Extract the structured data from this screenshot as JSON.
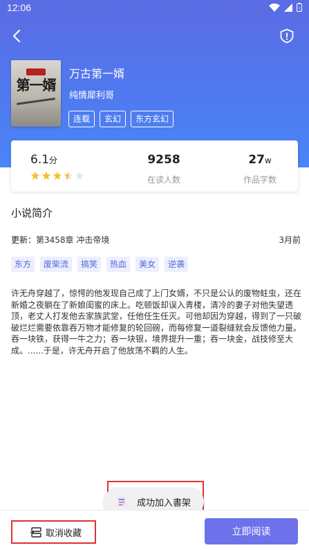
{
  "status": {
    "time": "12:06"
  },
  "book": {
    "title": "万古第一婿",
    "author": "纯情犀利哥",
    "tags": [
      "连载",
      "玄幻",
      "东方玄幻"
    ],
    "cover_text": "第一婿"
  },
  "stats": {
    "rating_value": "6.1",
    "rating_unit": "分",
    "stars": 3.5,
    "readers_value": "9258",
    "readers_label": "在读人数",
    "words_value": "27",
    "words_unit": "w",
    "words_label": "作品字数"
  },
  "intro": {
    "title": "小说简介",
    "update_label": "更新：",
    "update_chapter": "第3458章 冲击帝境",
    "update_time": "3月前",
    "genre_tags": [
      "东方",
      "废柴流",
      "搞笑",
      "热血",
      "美女",
      "逆袭"
    ],
    "synopsis": "许无舟穿越了，惊愕的他发现自己成了上门女婿，不只是公认的废物蛀虫，还在新婚之夜躺在了新娘闺蜜的床上。吃顿饭却误入青楼，清冷的妻子对他失望透顶，老丈人打发他去家族武堂，任他任生任灭。可他却因为穿越，得到了一只破破烂烂需要依靠吞万物才能修复的轮回碗，而每修复一道裂缝就会反馈他力量。吞一块铁，获得一牛之力；吞一块银，境界提升一重；吞一块金，战技修至大成。......于是，许无舟开启了他放荡不羁的人生。"
  },
  "toast": {
    "text": "成功加入書架"
  },
  "bottom": {
    "unfavorite_label": "取消收藏",
    "read_label": "立即阅读"
  },
  "colors": {
    "header_gradient_start": "#5b6be3",
    "header_gradient_end": "#4a86f7",
    "accent": "#6d72ea",
    "star": "#f5c02a",
    "highlight_red": "#e03030"
  }
}
